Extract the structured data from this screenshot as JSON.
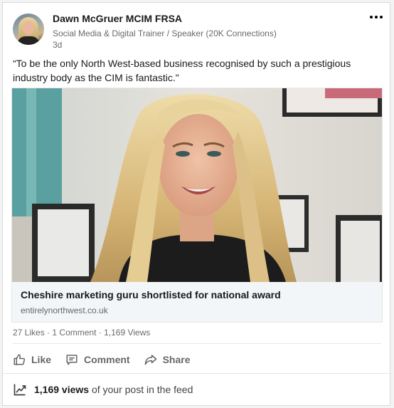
{
  "post": {
    "author": "Dawn McGruer MCIM FRSA",
    "headline": "Social Media & Digital Trainer / Speaker (20K Connections)",
    "time": "3d",
    "commentary": "“To be the only North West-based business recognised by such a prestigious industry body as the CIM is fantastic.\""
  },
  "article": {
    "title": "Cheshire marketing guru shortlisted for national award",
    "source": "entirelynorthwest.co.uk"
  },
  "social_counts": {
    "likes": "27 Likes",
    "separator": "·",
    "comments": "1 Comment",
    "views": "1,169 Views"
  },
  "actions": {
    "like": "Like",
    "comment": "Comment",
    "share": "Share"
  },
  "analytics": {
    "views_bold": "1,169 views",
    "views_rest": " of your post in the feed"
  },
  "icons": {
    "more": "ellipsis-icon",
    "like": "thumbs-up-icon",
    "comment": "speech-bubble-icon",
    "share": "share-arrow-icon",
    "analytics": "trending-up-icon"
  }
}
